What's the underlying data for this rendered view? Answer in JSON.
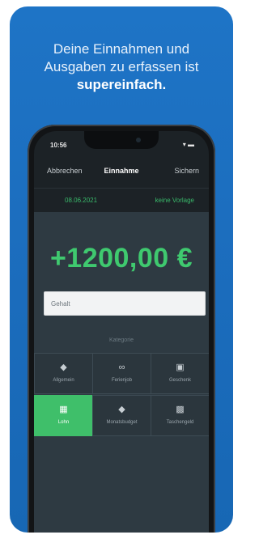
{
  "headline": {
    "line1": "Deine Einnahmen und",
    "line2": "Ausgaben zu erfassen ist",
    "line3": "supereinfach."
  },
  "status": {
    "time": "10:56",
    "icons": "▾ ▬"
  },
  "nav": {
    "cancel": "Abbrechen",
    "title": "Einnahme",
    "save": "Sichern"
  },
  "entry": {
    "date": "08.06.2021",
    "repeat": "keine Vorlage",
    "amount": "+1200,00 €",
    "description": "Gehalt",
    "category_label": "Kategorie"
  },
  "categories": [
    {
      "label": "Allgemein",
      "icon": "tag-icon",
      "selected": false
    },
    {
      "label": "Ferienjob",
      "icon": "link-icon",
      "selected": false
    },
    {
      "label": "Geschenk",
      "icon": "gift-icon",
      "selected": false
    },
    {
      "label": "Lohn",
      "icon": "money-icon",
      "selected": true
    },
    {
      "label": "Monatsbudget",
      "icon": "tag-icon",
      "selected": false
    },
    {
      "label": "Taschengeld",
      "icon": "chat-icon",
      "selected": false
    }
  ],
  "colors": {
    "card_blue": "#1b6cbc",
    "accent_green": "#3fc96f",
    "panel": "#2e3a42"
  }
}
